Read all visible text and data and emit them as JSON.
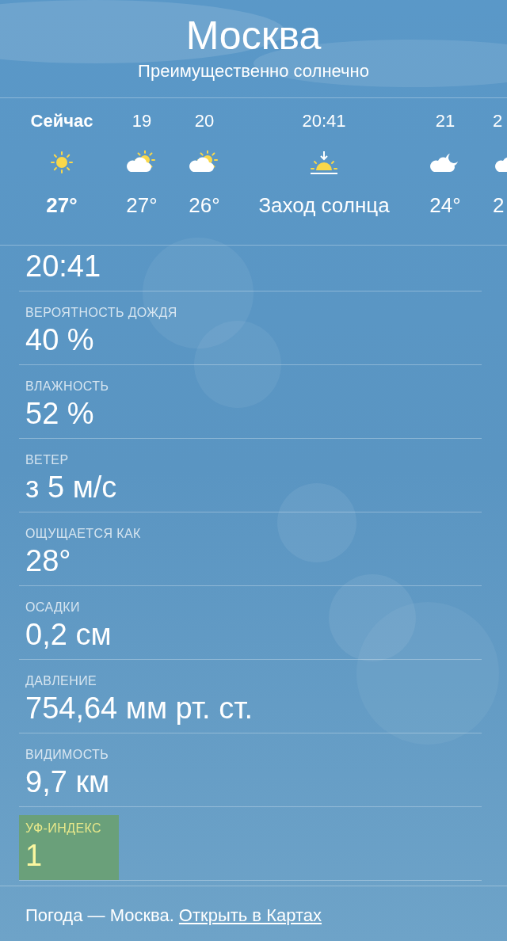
{
  "header": {
    "city": "Москва",
    "condition": "Преимущественно солнечно"
  },
  "hourly": [
    {
      "time": "Сейчас",
      "kind": "sun",
      "temp": "27°",
      "current": true
    },
    {
      "time": "19",
      "kind": "partly_cloudy",
      "temp": "27°",
      "current": false
    },
    {
      "time": "20",
      "kind": "partly_cloudy",
      "temp": "26°",
      "current": false
    },
    {
      "time": "20:41",
      "kind": "sunset",
      "temp": "Заход солнца",
      "current": false
    },
    {
      "time": "21",
      "kind": "partly_cloudy_night",
      "temp": "24°",
      "current": false
    },
    {
      "time": "2",
      "kind": "cloud",
      "temp": "2",
      "current": false
    }
  ],
  "details": [
    {
      "value": "20:41",
      "highlighted": false
    },
    {
      "label": "ВЕРОЯТНОСТЬ ДОЖДЯ",
      "value": "40 %",
      "highlighted": false
    },
    {
      "label": "ВЛАЖНОСТЬ",
      "value": "52 %",
      "highlighted": false
    },
    {
      "label": "ВЕТЕР",
      "value": "з 5 м/с",
      "highlighted": false
    },
    {
      "label": "ОЩУЩАЕТСЯ КАК",
      "value": "28°",
      "highlighted": false
    },
    {
      "label": "ОСАДКИ",
      "value": "0,2 см",
      "highlighted": false
    },
    {
      "label": "ДАВЛЕНИЕ",
      "value": "754,64 мм рт. ст.",
      "highlighted": false
    },
    {
      "label": "ВИДИМОСТЬ",
      "value": "9,7 км",
      "highlighted": false
    },
    {
      "label": "УФ-ИНДЕКС",
      "value": "1",
      "highlighted": true
    }
  ],
  "footer": {
    "text": "Погода — Москва.",
    "link": "Открыть в Картах"
  }
}
